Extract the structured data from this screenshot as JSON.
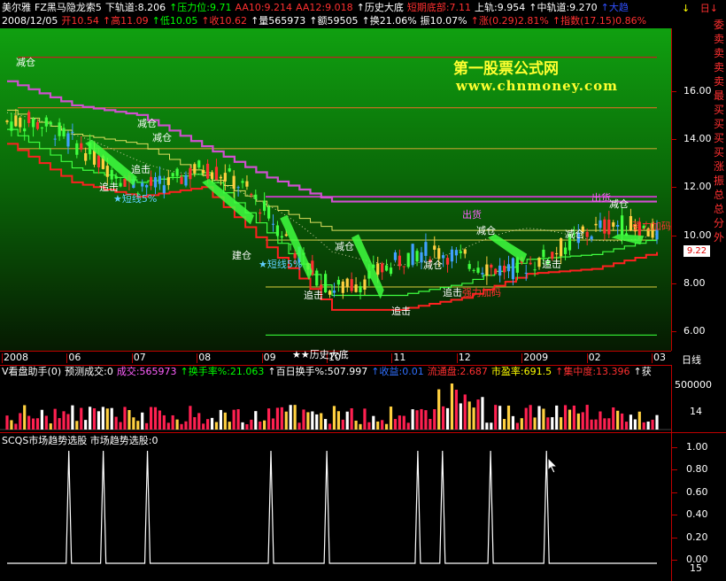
{
  "header": {
    "line1": [
      {
        "t": "美尔雅",
        "c": "#ffffff"
      },
      {
        "t": "FZ黑马隐龙索5",
        "c": "#ffffff"
      },
      {
        "t": "下轨道:8.206",
        "c": "#ffffff"
      },
      {
        "t": "↑压力位:9.71",
        "c": "#00ff00"
      },
      {
        "t": "AA10:9.214",
        "c": "#ff3030"
      },
      {
        "t": "AA12:9.018",
        "c": "#ff3030"
      },
      {
        "t": "↑历史大底",
        "c": "#ffffff"
      },
      {
        "t": "短期底部:7.11",
        "c": "#ff3030"
      },
      {
        "t": "上轨:9.954",
        "c": "#ffffff"
      },
      {
        "t": "↑中轨道:9.270",
        "c": "#ffffff"
      },
      {
        "t": "↑大趋",
        "c": "#3050ff"
      }
    ],
    "line2": [
      {
        "t": "2008/12/05",
        "c": "#ffffff"
      },
      {
        "t": "开10.54",
        "c": "#ff3030"
      },
      {
        "t": "↑高11.09",
        "c": "#ff3030"
      },
      {
        "t": "↑低10.05",
        "c": "#00ff00"
      },
      {
        "t": "↑收10.62",
        "c": "#ff3030"
      },
      {
        "t": "↑量565973",
        "c": "#ffffff"
      },
      {
        "t": "↑额59505",
        "c": "#ffffff"
      },
      {
        "t": "↑换21.06%",
        "c": "#ffffff"
      },
      {
        "t": "振10.07%",
        "c": "#ffffff"
      },
      {
        "t": "↑涨(0.29)2.81%",
        "c": "#ff3030"
      },
      {
        "t": "↑指数(17.15)0.86%",
        "c": "#ff3030"
      }
    ],
    "top_right_icons": [
      "↓",
      "日↓"
    ]
  },
  "right_menu": [
    "委",
    "卖",
    "卖",
    "卖",
    "卖",
    "最",
    "买",
    "买",
    "买",
    "买",
    "涨",
    "振",
    "总",
    "总",
    "分",
    "外"
  ],
  "watermark": {
    "title": "第一股票公式网",
    "url": "www.chnmoney.com"
  },
  "price_panel": {
    "y_ticks": [
      "16.00",
      "14.00",
      "12.00",
      "10.00",
      "8.00",
      "6.00"
    ],
    "current_price": "9.22",
    "annotations": [
      {
        "t": "减仓",
        "x": 18,
        "y": 62,
        "c": "#ffffff"
      },
      {
        "t": "减仓",
        "x": 155,
        "y": 131,
        "c": "#ffffff"
      },
      {
        "t": "减仓",
        "x": 172,
        "y": 147,
        "c": "#ffffff"
      },
      {
        "t": "追击",
        "x": 112,
        "y": 203,
        "c": "#ffffff"
      },
      {
        "t": "★短线5%",
        "x": 128,
        "y": 216,
        "c": "#60d0ff"
      },
      {
        "t": "追击",
        "x": 148,
        "y": 183,
        "c": "#ffffff"
      },
      {
        "t": "建仓",
        "x": 262,
        "y": 280,
        "c": "#ffffff"
      },
      {
        "t": "★短线5%",
        "x": 292,
        "y": 290,
        "c": "#60d0ff"
      },
      {
        "t": "减仓",
        "x": 378,
        "y": 270,
        "c": "#ffffff"
      },
      {
        "t": "追击",
        "x": 343,
        "y": 325,
        "c": "#ffffff"
      },
      {
        "t": "追击",
        "x": 442,
        "y": 343,
        "c": "#ffffff"
      },
      {
        "t": "减仓",
        "x": 478,
        "y": 291,
        "c": "#ffffff"
      },
      {
        "t": "追击",
        "x": 500,
        "y": 322,
        "c": "#ffffff"
      },
      {
        "t": "出货",
        "x": 522,
        "y": 234,
        "c": "#ff60ff"
      },
      {
        "t": "减仓",
        "x": 538,
        "y": 252,
        "c": "#ffffff"
      },
      {
        "t": "强力加码",
        "x": 522,
        "y": 322,
        "c": "#ff3030"
      },
      {
        "t": "追击",
        "x": 612,
        "y": 290,
        "c": "#ffffff"
      },
      {
        "t": "减仓",
        "x": 638,
        "y": 256,
        "c": "#ffffff"
      },
      {
        "t": "出货",
        "x": 668,
        "y": 215,
        "c": "#ff60ff"
      },
      {
        "t": "减仓",
        "x": 688,
        "y": 222,
        "c": "#ffffff"
      },
      {
        "t": "强力加码",
        "x": 714,
        "y": 247,
        "c": "#ff3030"
      },
      {
        "t": "★★历史大底",
        "x": 330,
        "y": 392,
        "c": "#ffffff"
      }
    ]
  },
  "time_axis": {
    "labels": [
      "2008",
      "06",
      "07",
      "08",
      "09",
      "10",
      "11",
      "12",
      "2009",
      "02",
      "03"
    ],
    "period": "日线"
  },
  "volume_panel": {
    "header": [
      {
        "t": "V看盘助手(0)",
        "c": "#ffffff"
      },
      {
        "t": "预测成交:0",
        "c": "#ffffff"
      },
      {
        "t": "成交:565973",
        "c": "#ff60ff"
      },
      {
        "t": "↑换手率%:21.063",
        "c": "#00ff00"
      },
      {
        "t": "↑百日换手%:507.997",
        "c": "#ffffff"
      },
      {
        "t": "↑收益:0.01",
        "c": "#3070ff"
      },
      {
        "t": "流通盘:2.687",
        "c": "#ff3030"
      },
      {
        "t": "市盈率:691.5",
        "c": "#ffff00"
      },
      {
        "t": "↑集中度:13.396",
        "c": "#ff3030"
      },
      {
        "t": "↑获",
        "c": "#ffffff"
      }
    ],
    "y_ticks": [
      "500000",
      "14"
    ]
  },
  "indicator_panel": {
    "header": "SCQS市场趋势选股  市场趋势选股:0",
    "y_ticks": [
      "1.00",
      "0.80",
      "0.60",
      "0.40",
      "0.20",
      "0.00",
      "15"
    ]
  },
  "chart_data": {
    "type": "line",
    "title": "美尔雅 FZ黑马隐龙索5",
    "x": [
      "2008",
      "06",
      "07",
      "08",
      "09",
      "10",
      "11",
      "12",
      "2009",
      "02",
      "03"
    ],
    "series": [
      {
        "name": "短期底部",
        "values": [
          13.8,
          12.2,
          11.6,
          12.0,
          9.5,
          6.9,
          6.9,
          7.4,
          8.4,
          8.6,
          9.3
        ]
      },
      {
        "name": "上轨",
        "values": [
          16.4,
          15.4,
          15.0,
          13.7,
          12.4,
          11.4,
          11.4,
          11.4,
          11.4,
          11.4,
          11.4
        ]
      }
    ],
    "y_range": [
      5.2,
      18.6
    ],
    "indicator": {
      "name": "市场趋势选股",
      "y_range": [
        0,
        1
      ],
      "spike_positions": [
        0.095,
        0.148,
        0.216,
        0.406,
        0.492,
        0.632,
        0.67,
        0.744,
        0.83
      ]
    }
  }
}
